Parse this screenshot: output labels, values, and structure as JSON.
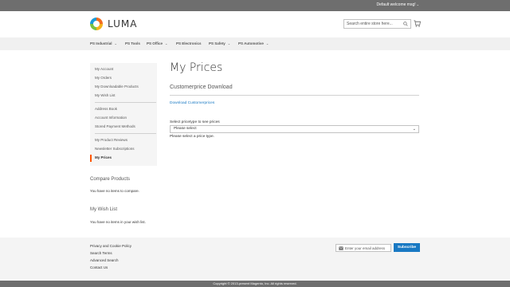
{
  "topbar": {
    "welcome": "Default welcome msg!",
    "caret": "⌄"
  },
  "header": {
    "logo_text": "LUMA",
    "search_placeholder": "Search entire store here...",
    "search_icon": "search-icon",
    "cart_icon": "cart-icon"
  },
  "nav": {
    "items": [
      {
        "label": "PS Industrial",
        "chevron": "⌄"
      },
      {
        "label": "PS Tools",
        "chevron": ""
      },
      {
        "label": "PS Office",
        "chevron": "⌄"
      },
      {
        "label": "PS Electronics",
        "chevron": ""
      },
      {
        "label": "PS Safety",
        "chevron": "⌄"
      },
      {
        "label": "PS Automotive",
        "chevron": "⌄"
      }
    ]
  },
  "sidebar": {
    "items": [
      {
        "label": "My Account"
      },
      {
        "label": "My Orders"
      },
      {
        "label": "My Downloadable Products"
      },
      {
        "label": "My Wish List"
      },
      {
        "label": "Address Book"
      },
      {
        "label": "Account Information"
      },
      {
        "label": "Stored Payment Methods"
      },
      {
        "label": "My Product Reviews"
      },
      {
        "label": "Newsletter Subscriptions"
      },
      {
        "label": "My Prices",
        "active": true
      }
    ]
  },
  "compare": {
    "title": "Compare Products",
    "text": "You have no items to compare."
  },
  "wishlist": {
    "title": "My Wish List",
    "text": "You have no items in your wish list."
  },
  "main": {
    "title": "My Prices",
    "section_title": "Customerprice Download",
    "download_link": "Download Customerprices",
    "select_label": "Select pricetype to see prices",
    "select_value": "Please select",
    "select_note": "Please select a price type."
  },
  "footer": {
    "links": [
      "Privacy and Cookie Policy",
      "Search Terms",
      "Advanced Search",
      "Contact Us"
    ],
    "newsletter_placeholder": "Enter your email address",
    "subscribe_label": "Subscribe",
    "copyright": "Copyright © 2013-present Magento, Inc. All rights reserved."
  },
  "colors": {
    "accent": "#1979c3",
    "active_marker": "#ff5501",
    "topbar": "#6e6e6e"
  }
}
